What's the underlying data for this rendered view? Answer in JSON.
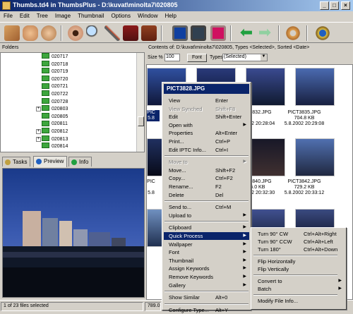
{
  "window": {
    "title": "Thumbs.td4 in ThumbsPlus - D:\\kuvat\\minolta7\\020805"
  },
  "menubar": [
    "File",
    "Edit",
    "Tree",
    "Image",
    "Thumbnail",
    "Options",
    "Window",
    "Help"
  ],
  "toolbar_icons": [
    "folder-hand-icon",
    "hand-icon",
    "open-hand-icon",
    "eye-icon",
    "magnifier-icon",
    "paintbrush-icon",
    "briefcase-icon",
    "camera-icon",
    "screen-icon",
    "slideshow-icon",
    "pink-frame-icon",
    "back-arrow-icon",
    "forward-arrow-icon",
    "donut-icon",
    "help-icon"
  ],
  "folders": {
    "header": "Folders",
    "items": [
      "020717",
      "020718",
      "020719",
      "020720",
      "020721",
      "020722",
      "020728",
      "020803",
      "020805",
      "020811",
      "020812",
      "020813",
      "020814"
    ]
  },
  "tabs": [
    "Tasks",
    "Preview",
    "Info"
  ],
  "address": "Contents of: D:\\kuvat\\minolta7\\020805, Types <Selected>, Sorted <Date>",
  "sizebar": {
    "size_label": "Size %",
    "size_value": "100",
    "font_button": "Font",
    "types_label": "Types:",
    "types_value": "(Selected)"
  },
  "thumbs": [
    {
      "name": "PIC",
      "line2": "5.8"
    },
    {
      "name": "PICT3832.JPG",
      "line2": "5.8.2002 20:28:04"
    },
    {
      "name": "PICT3835.JPG",
      "line2": "704.8 KB",
      "line3": "5.8.2002 20:29:08"
    },
    {
      "name": "PIC",
      "line2": "5.8"
    },
    {
      "name": "PICT3840.JPG",
      "line2": "755.0 KB",
      "line3": "5.8.2002 20:32:30"
    },
    {
      "name": "PICT3842.JPG",
      "line2": "729.2 KB",
      "line3": "5.8.2002 20:33:12"
    }
  ],
  "context_menu": {
    "header": "PICT3828.JPG",
    "items": [
      {
        "label": "View",
        "shortcut": "Enter"
      },
      {
        "label": "View Synched",
        "shortcut": "Shift+F8",
        "disabled": true
      },
      {
        "label": "Edit",
        "shortcut": "Shift+Enter"
      },
      {
        "label": "Open with",
        "arrow": true
      },
      {
        "label": "Properties",
        "shortcut": "Alt+Enter"
      },
      {
        "label": "Print...",
        "shortcut": "Ctrl+P"
      },
      {
        "label": "Edit IPTC Info...",
        "shortcut": "Ctrl+I"
      },
      {
        "sep": true
      },
      {
        "label": "Move to",
        "arrow": true,
        "disabled": true
      },
      {
        "label": "Move...",
        "shortcut": "Shift+F2"
      },
      {
        "label": "Copy...",
        "shortcut": "Ctrl+F2"
      },
      {
        "label": "Rename...",
        "shortcut": "F2"
      },
      {
        "label": "Delete",
        "shortcut": "Del"
      },
      {
        "sep": true
      },
      {
        "label": "Send to...",
        "shortcut": "Ctrl+M"
      },
      {
        "label": "Upload to",
        "arrow": true
      },
      {
        "sep": true
      },
      {
        "label": "Clipboard",
        "arrow": true
      },
      {
        "label": "Quick Process",
        "arrow": true,
        "highlighted": true
      },
      {
        "label": "Wallpaper",
        "arrow": true
      },
      {
        "label": "Font",
        "arrow": true
      },
      {
        "label": "Thumbnail",
        "arrow": true
      },
      {
        "label": "Assign Keywords",
        "arrow": true
      },
      {
        "label": "Remove Keywords",
        "arrow": true
      },
      {
        "label": "Gallery",
        "arrow": true
      },
      {
        "sep": true
      },
      {
        "label": "Show Similar",
        "shortcut": "Alt+0"
      },
      {
        "sep": true
      },
      {
        "label": "Configure Type...",
        "shortcut": "Alt+Y"
      }
    ]
  },
  "submenu": {
    "items": [
      {
        "label": "Turn 90° CW",
        "shortcut": "Ctrl+Alt+Right"
      },
      {
        "label": "Turn 90° CCW",
        "shortcut": "Ctrl+Alt+Left"
      },
      {
        "label": "Turn 180°",
        "shortcut": "Ctrl+Alt+Down"
      },
      {
        "sep": true
      },
      {
        "label": "Flip Horizontally"
      },
      {
        "label": "Flip Vertically"
      },
      {
        "sep": true
      },
      {
        "label": "Convert to",
        "arrow": true
      },
      {
        "label": "Batch",
        "arrow": true
      },
      {
        "sep": true
      },
      {
        "label": "Modify File Info..."
      }
    ]
  },
  "status": [
    "1 of 23 files selected",
    "789.01 Kb of 18.77 Mb selected, 45.12 G"
  ]
}
